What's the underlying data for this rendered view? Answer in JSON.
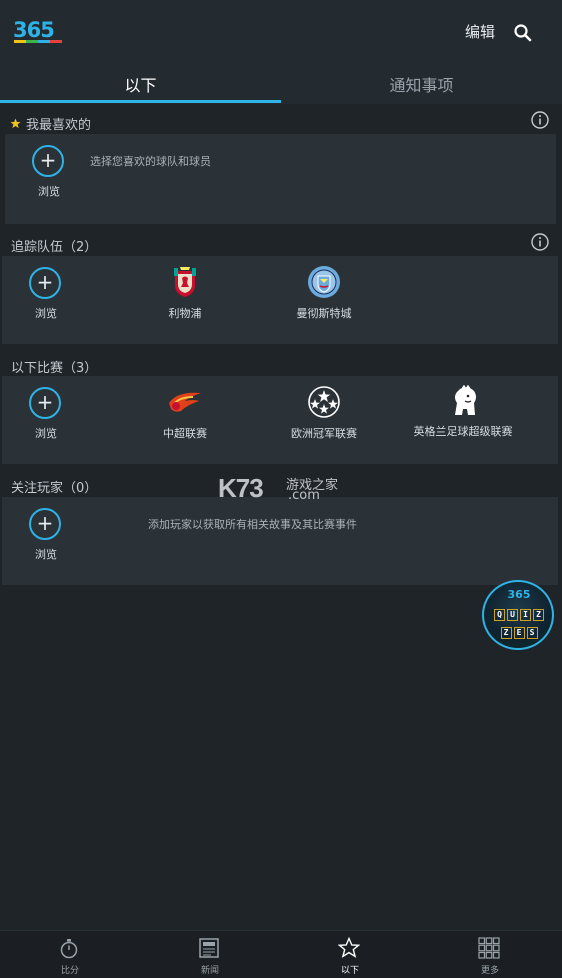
{
  "header": {
    "logo_text": "365",
    "edit_label": "编辑",
    "search_icon": "search-icon"
  },
  "tabs": [
    {
      "label": "以下",
      "active": true
    },
    {
      "label": "通知事项",
      "active": false
    }
  ],
  "sections": {
    "favorites": {
      "title": "我最喜欢的",
      "browse_label": "浏览",
      "hint": "选择您喜欢的球队和球员"
    },
    "teams": {
      "title": "追踪队伍（2）",
      "browse_label": "浏览",
      "items": [
        {
          "label": "利物浦",
          "icon": "liverpool-crest-icon"
        },
        {
          "label": "曼彻斯特城",
          "icon": "man-city-crest-icon"
        }
      ]
    },
    "competitions": {
      "title": "以下比赛（3）",
      "browse_label": "浏览",
      "items": [
        {
          "label": "中超联赛",
          "icon": "csl-logo-icon"
        },
        {
          "label": "欧洲冠军联赛",
          "icon": "champions-league-icon"
        },
        {
          "label": "英格兰足球超级联赛",
          "icon": "premier-league-lion-icon"
        }
      ]
    },
    "players": {
      "title": "关注玩家（0）",
      "browse_label": "浏览",
      "hint": "添加玩家以获取所有相关故事及其比赛事件"
    }
  },
  "quiz_badge": {
    "logo": "365",
    "row1": [
      "Q",
      "U",
      "I",
      "Z"
    ],
    "row2": [
      "Z",
      "E",
      "S"
    ]
  },
  "watermark": {
    "brand": "K73",
    "cn": "游戏之家",
    "domain": ".com"
  },
  "bottom_nav": [
    {
      "label": "比分",
      "icon": "stopwatch-icon",
      "active": false
    },
    {
      "label": "新闻",
      "icon": "newspaper-icon",
      "active": false
    },
    {
      "label": "以下",
      "icon": "star-icon",
      "active": true
    },
    {
      "label": "更多",
      "icon": "grid-icon",
      "active": false
    }
  ],
  "colors": {
    "accent": "#2fb3e6",
    "background": "#1f2429",
    "card": "#2a3137"
  }
}
